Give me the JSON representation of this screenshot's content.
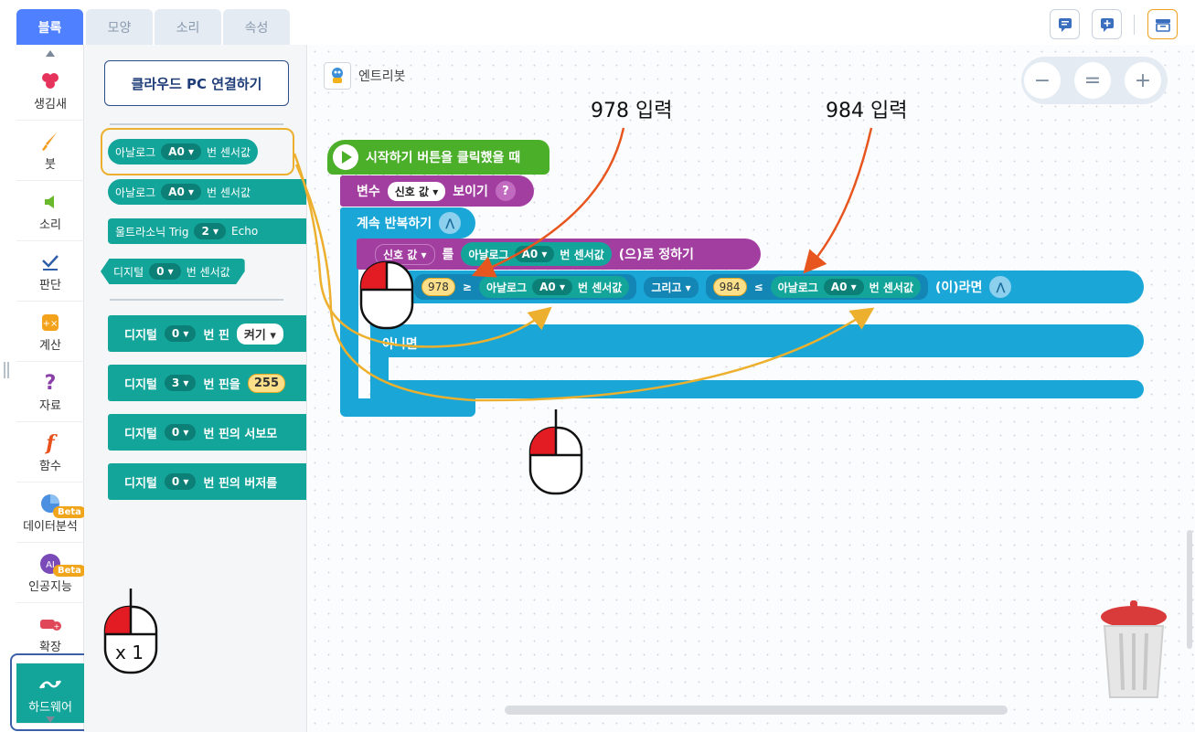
{
  "tabs": [
    "블록",
    "모양",
    "소리",
    "속성"
  ],
  "categories": [
    {
      "label": "생김새",
      "icon": "looks-icon"
    },
    {
      "label": "붓",
      "icon": "brush-icon"
    },
    {
      "label": "소리",
      "icon": "sound-icon"
    },
    {
      "label": "판단",
      "icon": "judge-icon"
    },
    {
      "label": "계산",
      "icon": "calc-icon"
    },
    {
      "label": "자료",
      "icon": "data-icon"
    },
    {
      "label": "함수",
      "icon": "function-icon"
    },
    {
      "label": "데이터분석",
      "icon": "data-analysis-icon",
      "badge": "Beta"
    },
    {
      "label": "인공지능",
      "icon": "ai-icon",
      "badge": "Beta",
      "icon_text": "AI"
    },
    {
      "label": "확장",
      "icon": "extension-icon"
    },
    {
      "label": "하드웨어",
      "icon": "hardware-icon"
    }
  ],
  "palette": {
    "cloud_button": "클라우드 PC 연결하기",
    "blocks": [
      {
        "pre": "아날로그",
        "dd": "A0",
        "post": "번 센서값"
      },
      {
        "pre": "아날로그",
        "dd": "A0",
        "post": "번 센서값"
      },
      {
        "pre": "울트라소닉 Trig",
        "dd": "2",
        "post": "Echo"
      },
      {
        "pre": "디지털",
        "dd": "0",
        "post": "번 센서값"
      },
      {
        "pre": "디지털",
        "dd": "0",
        "post": "번  핀",
        "extra": "켜기"
      },
      {
        "pre": "디지털",
        "dd": "3",
        "post": "번 핀을",
        "extra": "255"
      },
      {
        "pre": "디지털",
        "dd": "0",
        "post": "번 핀의 서보모"
      },
      {
        "pre": "디지털",
        "dd": "0",
        "post": "번 핀의 버저를"
      }
    ]
  },
  "canvas": {
    "object_name": "엔트리봇",
    "zoom": [
      "−",
      "=",
      "+"
    ],
    "annotations": [
      "978 입력",
      "984 입력"
    ],
    "mouse_label": "x 1",
    "script": {
      "start": "시작하기 버튼을 클릭했을 때",
      "show_var": {
        "pre": "변수",
        "dd": "신호 값",
        "post": "보이기"
      },
      "repeat": "계속 반복하기",
      "set_var": {
        "dd": "신호 값",
        "mid": "를",
        "analog": "아날로그",
        "adc": "A0",
        "sensor": "번 센서값",
        "post": "(으)로 정하기"
      },
      "if": {
        "v1": "978",
        "op1": "≥",
        "analog1": "아날로그",
        "a1": "A0",
        "s1": "번 센서값",
        "and": "그리고",
        "v2": "984",
        "op2": "≤",
        "analog2": "아날로그",
        "a2": "A0",
        "s2": "번 센서값",
        "post": "(이)라면"
      },
      "else": "아니면"
    }
  }
}
